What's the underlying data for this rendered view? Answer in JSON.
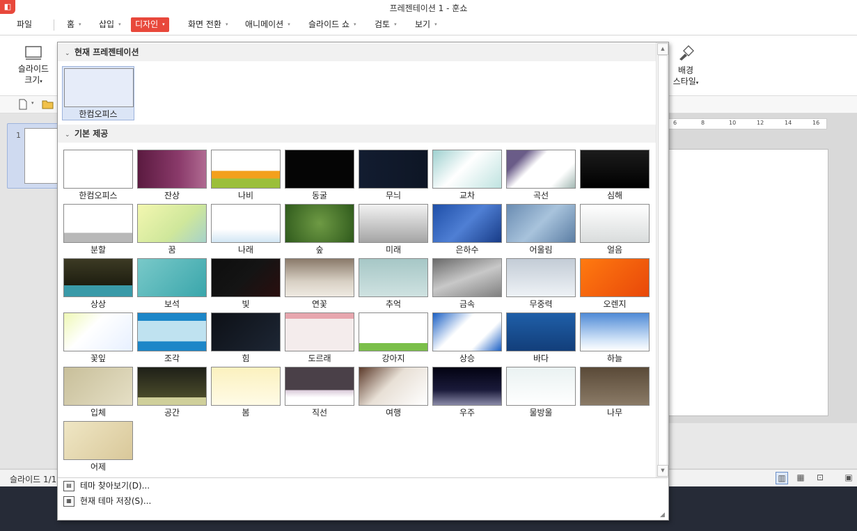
{
  "window": {
    "title": "프레젠테이션 1 - 훈쇼"
  },
  "menu": [
    {
      "label": "파일",
      "name": "menu-file",
      "arrow": ""
    },
    {
      "label": "홈",
      "name": "menu-home",
      "arrow": "▾"
    },
    {
      "label": "삽입",
      "name": "menu-insert",
      "arrow": "▾"
    },
    {
      "label": "디자인",
      "name": "menu-design",
      "arrow": "▾",
      "active": true
    },
    {
      "label": "화면 전환",
      "name": "menu-transition",
      "arrow": "▾"
    },
    {
      "label": "애니메이션",
      "name": "menu-animation",
      "arrow": "▾"
    },
    {
      "label": "슬라이드 쇼",
      "name": "menu-slideshow",
      "arrow": "▾"
    },
    {
      "label": "검토",
      "name": "menu-review",
      "arrow": "▾"
    },
    {
      "label": "보기",
      "name": "menu-view",
      "arrow": "▾"
    }
  ],
  "ribbon": {
    "slide_size": {
      "line1": "슬라이드",
      "line2": "크기",
      "caret": "▾"
    },
    "bg_style": {
      "line1": "배경",
      "line2": "스타일",
      "caret": "▾"
    }
  },
  "ruler": [
    "6",
    "8",
    "10",
    "12",
    "14",
    "16"
  ],
  "slide_panel": {
    "number": "1"
  },
  "status": {
    "text": "슬라이드 1/1"
  },
  "theme_popup": {
    "current_section": "현재 프레젠테이션",
    "current_theme": {
      "label": "한컴오피스"
    },
    "basic_section": "기본 제공",
    "themes": [
      {
        "label": "한컴오피스",
        "bg": "#ffffff"
      },
      {
        "label": "잔상",
        "bg": "linear-gradient(90deg,#5b1a40,#8a3a6a 60%,#b06b92)"
      },
      {
        "label": "나비",
        "bg": "linear-gradient(180deg,#ffffff 55%,#f3a01c 55%,#f3a01c 75%,#9bbf3a 75%)"
      },
      {
        "label": "동굴",
        "bg": "#050505"
      },
      {
        "label": "무늬",
        "bg": "linear-gradient(90deg,#121c30,#0e1625)"
      },
      {
        "label": "교차",
        "bg": "linear-gradient(135deg,#9ed0cf,#ffffff 45%,#bfe3e0)"
      },
      {
        "label": "곡선",
        "bg": "linear-gradient(135deg,#6a5c88 20%,#ffffff 40%,#ffffff 75%,#a3b8b3)"
      },
      {
        "label": "심해",
        "bg": "linear-gradient(180deg,#1c1c1c,#000000)"
      },
      {
        "label": "분할",
        "bg": "linear-gradient(180deg,#ffffff 75%,#b8b8b8 75%)"
      },
      {
        "label": "꿈",
        "bg": "linear-gradient(135deg,#f3f7b0,#cfe79b 60%,#a6d2c9)"
      },
      {
        "label": "나래",
        "bg": "linear-gradient(180deg,#ffffff 65%,#d2e6f4)"
      },
      {
        "label": "숲",
        "bg": "radial-gradient(circle,#6e9a44,#2f5a1c)"
      },
      {
        "label": "미래",
        "bg": "linear-gradient(180deg,#f2f2f2,#a5a5a5)"
      },
      {
        "label": "은하수",
        "bg": "linear-gradient(135deg,#1f4fa8,#4f7fd4 50%,#183c88)"
      },
      {
        "label": "어울림",
        "bg": "linear-gradient(135deg,#6a8cb2,#a8c3dc 50%,#5c7ea4)"
      },
      {
        "label": "얼음",
        "bg": "linear-gradient(180deg,#ffffff,#d9dcdc)"
      },
      {
        "label": "상상",
        "bg": "linear-gradient(180deg,#3c3a24,#1e1e10 70%,#3a9aa8 70%)"
      },
      {
        "label": "보석",
        "bg": "linear-gradient(135deg,#79c9c9,#3aa6ab)"
      },
      {
        "label": "빛",
        "bg": "linear-gradient(135deg,#0e0e0e,#141414 50%,#2a0e0e)"
      },
      {
        "label": "연꽃",
        "bg": "linear-gradient(180deg,#8a7a6a,#d8d0c4 60%,#efeae2)"
      },
      {
        "label": "추억",
        "bg": "linear-gradient(180deg,#a6c7c6,#cfe2e1)"
      },
      {
        "label": "금속",
        "bg": "linear-gradient(160deg,#6a6a6a,#c8c8c8 50%,#808080)"
      },
      {
        "label": "무중력",
        "bg": "linear-gradient(180deg,#c3ccd6,#eef2f6)"
      },
      {
        "label": "오렌지",
        "bg": "linear-gradient(135deg,#ff7a10,#e8480a)"
      },
      {
        "label": "꽃잎",
        "bg": "linear-gradient(135deg,#eef8b5,#ffffff 40%,#e7f0ff)"
      },
      {
        "label": "조각",
        "bg": "linear-gradient(180deg,#1c86c8 20%,#bfe2f0 20%,#bfe2f0 75%,#1c86c8 75%)"
      },
      {
        "label": "힘",
        "bg": "linear-gradient(135deg,#0d1016,#1d2634)"
      },
      {
        "label": "도르래",
        "bg": "linear-gradient(180deg,#e7a6ae 15%,#f4ecec 15%)"
      },
      {
        "label": "강아지",
        "bg": "linear-gradient(180deg,#ffffff 80%,#7bbf4a 80%)"
      },
      {
        "label": "상승",
        "bg": "linear-gradient(135deg,#1a5fc4,#ffffff 40%,#ffffff 70%,#1a5fc4)"
      },
      {
        "label": "바다",
        "bg": "linear-gradient(180deg,#1f5fa8,#123e7a)"
      },
      {
        "label": "하늘",
        "bg": "linear-gradient(180deg,#4f8ad6,#cfe2f7 70%,#ffffff)"
      },
      {
        "label": "입체",
        "bg": "linear-gradient(135deg,#c8bf9a,#e5dfc5)"
      },
      {
        "label": "공간",
        "bg": "linear-gradient(180deg,#1e2018,#4a4a2a 80%,#cfcf9a 80%)"
      },
      {
        "label": "봄",
        "bg": "linear-gradient(180deg,#fbf1bf,#fffbe6)"
      },
      {
        "label": "직선",
        "bg": "linear-gradient(180deg,#4a4048 60%,#d8c8d8 60%,#ffffff 80%)"
      },
      {
        "label": "여행",
        "bg": "linear-gradient(135deg,#5c3a2a,#e8e0d6 45%,#ffffff)"
      },
      {
        "label": "우주",
        "bg": "linear-gradient(180deg,#030312,#1a1a3a 60%,#8a8aa8)"
      },
      {
        "label": "물방울",
        "bg": "linear-gradient(180deg,#eaf2f2,#ffffff)"
      },
      {
        "label": "나무",
        "bg": "linear-gradient(180deg,#5a4a38,#8a7a66)"
      },
      {
        "label": "어제",
        "bg": "linear-gradient(135deg,#efe6c4,#d9c89a)"
      }
    ],
    "footer": [
      {
        "label": "테마 찾아보기(D)...",
        "name": "browse-themes-item"
      },
      {
        "label": "현재 테마 저장(S)...",
        "name": "save-current-theme-item"
      }
    ]
  }
}
